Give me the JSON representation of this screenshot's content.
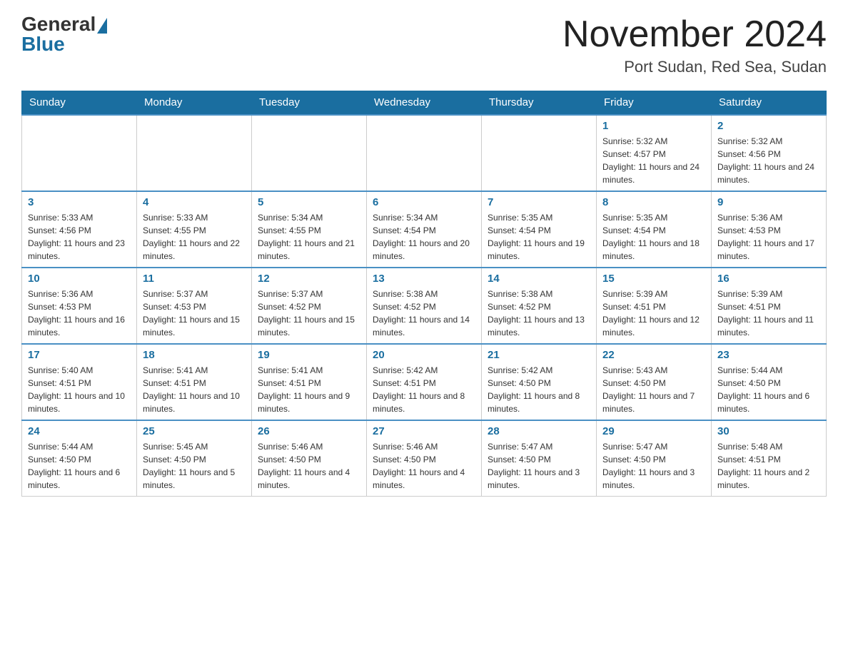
{
  "header": {
    "logo_general": "General",
    "logo_blue": "Blue",
    "month_title": "November 2024",
    "subtitle": "Port Sudan, Red Sea, Sudan"
  },
  "days_of_week": [
    "Sunday",
    "Monday",
    "Tuesday",
    "Wednesday",
    "Thursday",
    "Friday",
    "Saturday"
  ],
  "weeks": [
    [
      {
        "day": "",
        "sunrise": "",
        "sunset": "",
        "daylight": ""
      },
      {
        "day": "",
        "sunrise": "",
        "sunset": "",
        "daylight": ""
      },
      {
        "day": "",
        "sunrise": "",
        "sunset": "",
        "daylight": ""
      },
      {
        "day": "",
        "sunrise": "",
        "sunset": "",
        "daylight": ""
      },
      {
        "day": "",
        "sunrise": "",
        "sunset": "",
        "daylight": ""
      },
      {
        "day": "1",
        "sunrise": "Sunrise: 5:32 AM",
        "sunset": "Sunset: 4:57 PM",
        "daylight": "Daylight: 11 hours and 24 minutes."
      },
      {
        "day": "2",
        "sunrise": "Sunrise: 5:32 AM",
        "sunset": "Sunset: 4:56 PM",
        "daylight": "Daylight: 11 hours and 24 minutes."
      }
    ],
    [
      {
        "day": "3",
        "sunrise": "Sunrise: 5:33 AM",
        "sunset": "Sunset: 4:56 PM",
        "daylight": "Daylight: 11 hours and 23 minutes."
      },
      {
        "day": "4",
        "sunrise": "Sunrise: 5:33 AM",
        "sunset": "Sunset: 4:55 PM",
        "daylight": "Daylight: 11 hours and 22 minutes."
      },
      {
        "day": "5",
        "sunrise": "Sunrise: 5:34 AM",
        "sunset": "Sunset: 4:55 PM",
        "daylight": "Daylight: 11 hours and 21 minutes."
      },
      {
        "day": "6",
        "sunrise": "Sunrise: 5:34 AM",
        "sunset": "Sunset: 4:54 PM",
        "daylight": "Daylight: 11 hours and 20 minutes."
      },
      {
        "day": "7",
        "sunrise": "Sunrise: 5:35 AM",
        "sunset": "Sunset: 4:54 PM",
        "daylight": "Daylight: 11 hours and 19 minutes."
      },
      {
        "day": "8",
        "sunrise": "Sunrise: 5:35 AM",
        "sunset": "Sunset: 4:54 PM",
        "daylight": "Daylight: 11 hours and 18 minutes."
      },
      {
        "day": "9",
        "sunrise": "Sunrise: 5:36 AM",
        "sunset": "Sunset: 4:53 PM",
        "daylight": "Daylight: 11 hours and 17 minutes."
      }
    ],
    [
      {
        "day": "10",
        "sunrise": "Sunrise: 5:36 AM",
        "sunset": "Sunset: 4:53 PM",
        "daylight": "Daylight: 11 hours and 16 minutes."
      },
      {
        "day": "11",
        "sunrise": "Sunrise: 5:37 AM",
        "sunset": "Sunset: 4:53 PM",
        "daylight": "Daylight: 11 hours and 15 minutes."
      },
      {
        "day": "12",
        "sunrise": "Sunrise: 5:37 AM",
        "sunset": "Sunset: 4:52 PM",
        "daylight": "Daylight: 11 hours and 15 minutes."
      },
      {
        "day": "13",
        "sunrise": "Sunrise: 5:38 AM",
        "sunset": "Sunset: 4:52 PM",
        "daylight": "Daylight: 11 hours and 14 minutes."
      },
      {
        "day": "14",
        "sunrise": "Sunrise: 5:38 AM",
        "sunset": "Sunset: 4:52 PM",
        "daylight": "Daylight: 11 hours and 13 minutes."
      },
      {
        "day": "15",
        "sunrise": "Sunrise: 5:39 AM",
        "sunset": "Sunset: 4:51 PM",
        "daylight": "Daylight: 11 hours and 12 minutes."
      },
      {
        "day": "16",
        "sunrise": "Sunrise: 5:39 AM",
        "sunset": "Sunset: 4:51 PM",
        "daylight": "Daylight: 11 hours and 11 minutes."
      }
    ],
    [
      {
        "day": "17",
        "sunrise": "Sunrise: 5:40 AM",
        "sunset": "Sunset: 4:51 PM",
        "daylight": "Daylight: 11 hours and 10 minutes."
      },
      {
        "day": "18",
        "sunrise": "Sunrise: 5:41 AM",
        "sunset": "Sunset: 4:51 PM",
        "daylight": "Daylight: 11 hours and 10 minutes."
      },
      {
        "day": "19",
        "sunrise": "Sunrise: 5:41 AM",
        "sunset": "Sunset: 4:51 PM",
        "daylight": "Daylight: 11 hours and 9 minutes."
      },
      {
        "day": "20",
        "sunrise": "Sunrise: 5:42 AM",
        "sunset": "Sunset: 4:51 PM",
        "daylight": "Daylight: 11 hours and 8 minutes."
      },
      {
        "day": "21",
        "sunrise": "Sunrise: 5:42 AM",
        "sunset": "Sunset: 4:50 PM",
        "daylight": "Daylight: 11 hours and 8 minutes."
      },
      {
        "day": "22",
        "sunrise": "Sunrise: 5:43 AM",
        "sunset": "Sunset: 4:50 PM",
        "daylight": "Daylight: 11 hours and 7 minutes."
      },
      {
        "day": "23",
        "sunrise": "Sunrise: 5:44 AM",
        "sunset": "Sunset: 4:50 PM",
        "daylight": "Daylight: 11 hours and 6 minutes."
      }
    ],
    [
      {
        "day": "24",
        "sunrise": "Sunrise: 5:44 AM",
        "sunset": "Sunset: 4:50 PM",
        "daylight": "Daylight: 11 hours and 6 minutes."
      },
      {
        "day": "25",
        "sunrise": "Sunrise: 5:45 AM",
        "sunset": "Sunset: 4:50 PM",
        "daylight": "Daylight: 11 hours and 5 minutes."
      },
      {
        "day": "26",
        "sunrise": "Sunrise: 5:46 AM",
        "sunset": "Sunset: 4:50 PM",
        "daylight": "Daylight: 11 hours and 4 minutes."
      },
      {
        "day": "27",
        "sunrise": "Sunrise: 5:46 AM",
        "sunset": "Sunset: 4:50 PM",
        "daylight": "Daylight: 11 hours and 4 minutes."
      },
      {
        "day": "28",
        "sunrise": "Sunrise: 5:47 AM",
        "sunset": "Sunset: 4:50 PM",
        "daylight": "Daylight: 11 hours and 3 minutes."
      },
      {
        "day": "29",
        "sunrise": "Sunrise: 5:47 AM",
        "sunset": "Sunset: 4:50 PM",
        "daylight": "Daylight: 11 hours and 3 minutes."
      },
      {
        "day": "30",
        "sunrise": "Sunrise: 5:48 AM",
        "sunset": "Sunset: 4:51 PM",
        "daylight": "Daylight: 11 hours and 2 minutes."
      }
    ]
  ]
}
